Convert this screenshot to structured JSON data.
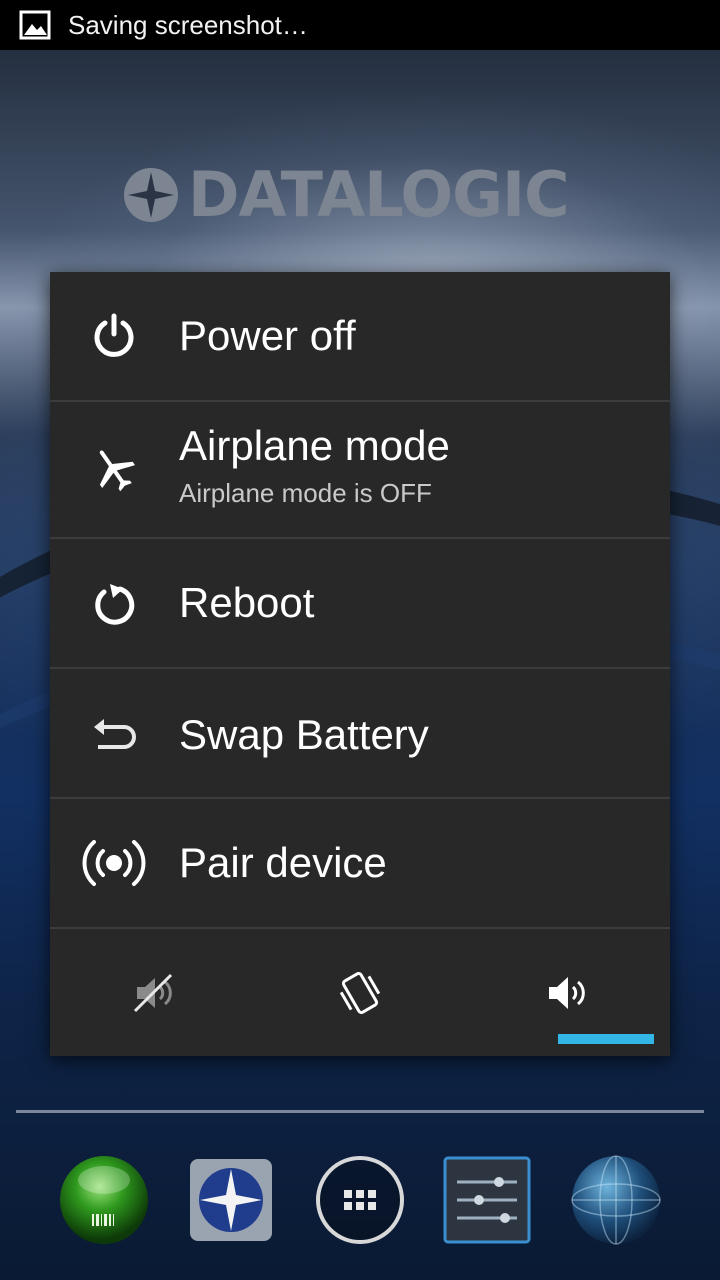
{
  "status_bar": {
    "notification_icon": "image-icon",
    "notification_text": "Saving screenshot…"
  },
  "wallpaper": {
    "brand_text": "DATALOGIC"
  },
  "power_menu": {
    "items": [
      {
        "icon": "power-icon",
        "label": "Power off"
      },
      {
        "icon": "airplane-icon",
        "label": "Airplane mode",
        "sublabel": "Airplane mode is OFF"
      },
      {
        "icon": "reboot-icon",
        "label": "Reboot"
      },
      {
        "icon": "swap-battery-icon",
        "label": "Swap Battery"
      },
      {
        "icon": "pair-device-icon",
        "label": "Pair device"
      }
    ],
    "sound_modes": [
      {
        "icon": "silent-icon",
        "selected": false
      },
      {
        "icon": "vibrate-icon",
        "selected": false
      },
      {
        "icon": "sound-on-icon",
        "selected": true
      }
    ],
    "accent_color": "#33b5e5"
  },
  "dock": {
    "apps": [
      {
        "icon": "barcode-scanner-app-icon"
      },
      {
        "icon": "datalogic-app-icon"
      },
      {
        "icon": "app-drawer-icon"
      },
      {
        "icon": "settings-app-icon"
      },
      {
        "icon": "browser-globe-icon"
      }
    ]
  }
}
